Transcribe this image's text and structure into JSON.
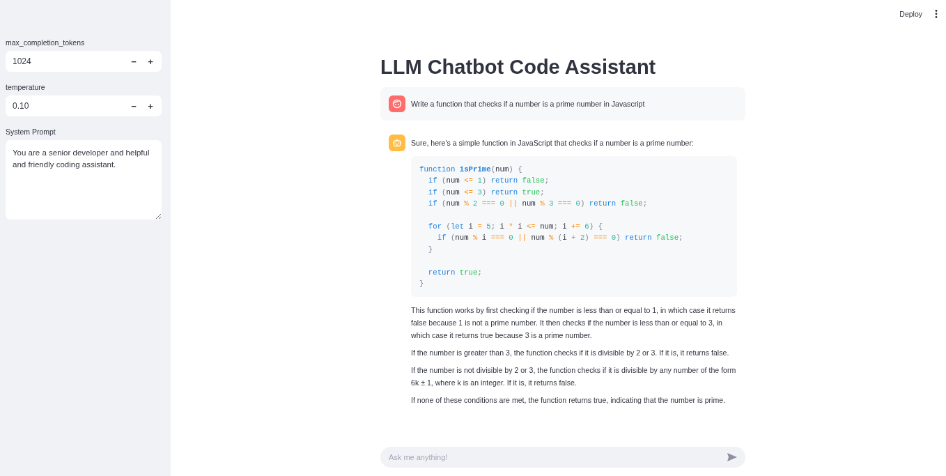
{
  "sidebar": {
    "fields": [
      {
        "kind": "number",
        "label": "max_completion_tokens",
        "value": "1024",
        "minus": "−",
        "plus": "+"
      },
      {
        "kind": "number",
        "label": "temperature",
        "value": "0.10",
        "minus": "−",
        "plus": "+"
      },
      {
        "kind": "textarea",
        "label": "System Prompt",
        "value": "You are a senior developer and helpful and friendly coding assistant."
      }
    ]
  },
  "header": {
    "deploy": "Deploy"
  },
  "title": "LLM Chatbot Code Assistant",
  "messages": [
    {
      "kind": "user",
      "parts": [
        {
          "kind": "text",
          "text": "Write a function that checks if a number is a prime number in Javascript"
        }
      ]
    },
    {
      "kind": "assistant",
      "parts": [
        {
          "kind": "text",
          "text": "Sure, here's a simple function in JavaScript that checks if a number is a prime number:"
        },
        {
          "kind": "code",
          "groups": [
            {
              "lines": [
                [
                  {
                    "kind": "kw",
                    "text": "function "
                  },
                  {
                    "kind": "fn",
                    "text": "isPrime"
                  },
                  {
                    "kind": "p",
                    "text": "("
                  },
                  {
                    "kind": "x",
                    "text": "num"
                  },
                  {
                    "kind": "p",
                    "text": ") {"
                  }
                ],
                [
                  {
                    "kind": "kw",
                    "text": "  if "
                  },
                  {
                    "kind": "p",
                    "text": "("
                  },
                  {
                    "kind": "x",
                    "text": "num "
                  },
                  {
                    "kind": "op",
                    "text": "<= "
                  },
                  {
                    "kind": "num",
                    "text": "1"
                  },
                  {
                    "kind": "p",
                    "text": ") "
                  },
                  {
                    "kind": "kw",
                    "text": "return "
                  },
                  {
                    "kind": "bool",
                    "text": "false"
                  },
                  {
                    "kind": "p",
                    "text": ";"
                  }
                ],
                [
                  {
                    "kind": "kw",
                    "text": "  if "
                  },
                  {
                    "kind": "p",
                    "text": "("
                  },
                  {
                    "kind": "x",
                    "text": "num "
                  },
                  {
                    "kind": "op",
                    "text": "<= "
                  },
                  {
                    "kind": "num",
                    "text": "3"
                  },
                  {
                    "kind": "p",
                    "text": ") "
                  },
                  {
                    "kind": "kw",
                    "text": "return "
                  },
                  {
                    "kind": "bool",
                    "text": "true"
                  },
                  {
                    "kind": "p",
                    "text": ";"
                  }
                ],
                [
                  {
                    "kind": "kw",
                    "text": "  if "
                  },
                  {
                    "kind": "p",
                    "text": "("
                  },
                  {
                    "kind": "x",
                    "text": "num "
                  },
                  {
                    "kind": "op",
                    "text": "% "
                  },
                  {
                    "kind": "num",
                    "text": "2 "
                  },
                  {
                    "kind": "op",
                    "text": "=== "
                  },
                  {
                    "kind": "num",
                    "text": "0 "
                  },
                  {
                    "kind": "op",
                    "text": "|| "
                  },
                  {
                    "kind": "x",
                    "text": "num "
                  },
                  {
                    "kind": "op",
                    "text": "% "
                  },
                  {
                    "kind": "num",
                    "text": "3 "
                  },
                  {
                    "kind": "op",
                    "text": "=== "
                  },
                  {
                    "kind": "num",
                    "text": "0"
                  },
                  {
                    "kind": "p",
                    "text": ") "
                  },
                  {
                    "kind": "kw",
                    "text": "return "
                  },
                  {
                    "kind": "bool",
                    "text": "false"
                  },
                  {
                    "kind": "p",
                    "text": ";"
                  }
                ]
              ]
            },
            {
              "lines": [
                [
                  {
                    "kind": "kw",
                    "text": "  for "
                  },
                  {
                    "kind": "p",
                    "text": "("
                  },
                  {
                    "kind": "kw",
                    "text": "let "
                  },
                  {
                    "kind": "x",
                    "text": "i "
                  },
                  {
                    "kind": "op",
                    "text": "= "
                  },
                  {
                    "kind": "num",
                    "text": "5"
                  },
                  {
                    "kind": "p",
                    "text": "; "
                  },
                  {
                    "kind": "x",
                    "text": "i "
                  },
                  {
                    "kind": "op",
                    "text": "* "
                  },
                  {
                    "kind": "x",
                    "text": "i "
                  },
                  {
                    "kind": "op",
                    "text": "<= "
                  },
                  {
                    "kind": "x",
                    "text": "num"
                  },
                  {
                    "kind": "p",
                    "text": "; "
                  },
                  {
                    "kind": "x",
                    "text": "i "
                  },
                  {
                    "kind": "op",
                    "text": "+= "
                  },
                  {
                    "kind": "num",
                    "text": "6"
                  },
                  {
                    "kind": "p",
                    "text": ") {"
                  }
                ],
                [
                  {
                    "kind": "kw",
                    "text": "    if "
                  },
                  {
                    "kind": "p",
                    "text": "("
                  },
                  {
                    "kind": "x",
                    "text": "num "
                  },
                  {
                    "kind": "op",
                    "text": "% "
                  },
                  {
                    "kind": "x",
                    "text": "i "
                  },
                  {
                    "kind": "op",
                    "text": "=== "
                  },
                  {
                    "kind": "num",
                    "text": "0 "
                  },
                  {
                    "kind": "op",
                    "text": "|| "
                  },
                  {
                    "kind": "x",
                    "text": "num "
                  },
                  {
                    "kind": "op",
                    "text": "% "
                  },
                  {
                    "kind": "p",
                    "text": "("
                  },
                  {
                    "kind": "x",
                    "text": "i "
                  },
                  {
                    "kind": "op",
                    "text": "+ "
                  },
                  {
                    "kind": "num",
                    "text": "2"
                  },
                  {
                    "kind": "p",
                    "text": ") "
                  },
                  {
                    "kind": "op",
                    "text": "=== "
                  },
                  {
                    "kind": "num",
                    "text": "0"
                  },
                  {
                    "kind": "p",
                    "text": ") "
                  },
                  {
                    "kind": "kw",
                    "text": "return "
                  },
                  {
                    "kind": "bool",
                    "text": "false"
                  },
                  {
                    "kind": "p",
                    "text": ";"
                  }
                ],
                [
                  {
                    "kind": "p",
                    "text": "  }"
                  }
                ]
              ]
            },
            {
              "lines": [
                [
                  {
                    "kind": "kw",
                    "text": "  return "
                  },
                  {
                    "kind": "bool",
                    "text": "true"
                  },
                  {
                    "kind": "p",
                    "text": ";"
                  }
                ],
                [
                  {
                    "kind": "p",
                    "text": "}"
                  }
                ]
              ]
            }
          ]
        },
        {
          "kind": "text",
          "text": "This function works by first checking if the number is less than or equal to 1, in which case it returns false because 1 is not a prime number. It then checks if the number is less than or equal to 3, in which case it returns true because 3 is a prime number."
        },
        {
          "kind": "text",
          "text": "If the number is greater than 3, the function checks if it is divisible by 2 or 3. If it is, it returns false."
        },
        {
          "kind": "text",
          "text": "If the number is not divisible by 2 or 3, the function checks if it is divisible by any number of the form 6k ± 1, where k is an integer. If it is, it returns false."
        },
        {
          "kind": "text",
          "text": "If none of these conditions are met, the function returns true, indicating that the number is prime."
        }
      ]
    }
  ],
  "chat_input": {
    "placeholder": "Ask me anything!"
  }
}
